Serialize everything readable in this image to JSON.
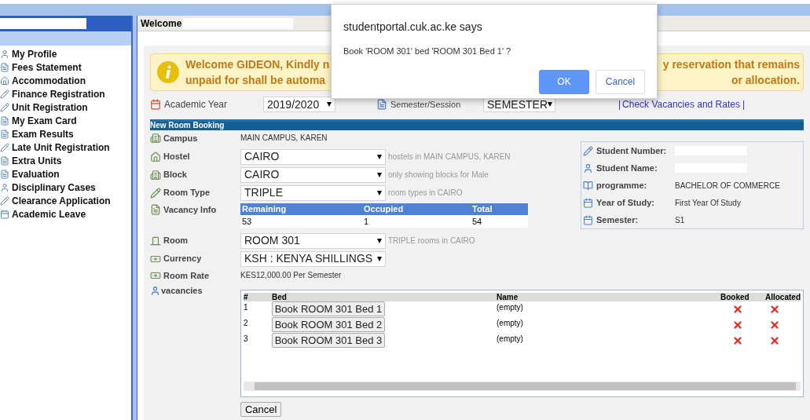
{
  "sidebar": {
    "items": [
      {
        "label": "My Profile"
      },
      {
        "label": "Fees Statement"
      },
      {
        "label": "Accommodation"
      },
      {
        "label": "Finance Registration"
      },
      {
        "label": "Unit Registration"
      },
      {
        "label": "My Exam Card"
      },
      {
        "label": "Exam Results"
      },
      {
        "label": "Late Unit Registration"
      },
      {
        "label": "Extra Units"
      },
      {
        "label": "Evaluation"
      },
      {
        "label": "Disciplinary Cases"
      },
      {
        "label": "Clearance Application"
      },
      {
        "label": "Academic Leave"
      }
    ]
  },
  "welcome_bar": {
    "text": "Welcome"
  },
  "notice": {
    "lines": [
      {
        "left": "Welcome GIDEON, Kindly n",
        "right": "y reservation that remains"
      },
      {
        "left": "unpaid for shall be automa",
        "right": "or allocation."
      }
    ]
  },
  "filters": {
    "academic_year": {
      "label": "Academic Year",
      "value": "2019/2020"
    },
    "semester": {
      "label": "Semester/Session",
      "value": "SEMESTER"
    },
    "link_prefix": "|",
    "link": "Check Vacancies and Rates",
    "link_suffix": "|"
  },
  "booking": {
    "title": "New Room Booking",
    "fields": [
      {
        "kind": "text",
        "label": "Campus",
        "value": "MAIN CAMPUS, KAREN"
      },
      {
        "kind": "select",
        "label": "Hostel",
        "value": "CAIRO",
        "hint": "hostels in MAIN CAMPUS, KAREN"
      },
      {
        "kind": "select",
        "label": "Block",
        "value": "CAIRO",
        "hint": "only showing blocks for Male"
      },
      {
        "kind": "select",
        "label": "Room Type",
        "value": "TRIPLE",
        "hint": "room types in CAIRO"
      },
      {
        "kind": "vacancy",
        "label": "Vacancy Info",
        "columns": [
          "Remaining",
          "Occupied",
          "Total"
        ],
        "values": [
          "53",
          "1",
          "54"
        ]
      },
      {
        "kind": "select",
        "label": "Room",
        "value": "ROOM 301",
        "hint": "TRIPLE rooms in CAIRO"
      },
      {
        "kind": "select",
        "label": "Currency",
        "value": "KSH : KENYA SHILLINGS"
      },
      {
        "kind": "text",
        "label": "Room Rate",
        "value": "KES12,000.00 Per Semester"
      }
    ],
    "vacancies_label": "vacancies"
  },
  "student_info": [
    {
      "label": "Student Number:"
    },
    {
      "label": "Student Name:"
    },
    {
      "label": "programme:",
      "value": "BACHELOR OF COMMERCE"
    },
    {
      "label": "Year of Study:",
      "value": "First Year Of Study"
    },
    {
      "label": "Semester:",
      "value": "S1"
    }
  ],
  "beds": {
    "columns": [
      "#",
      "Bed",
      "Name",
      "Booked",
      "Allocated"
    ],
    "rows": [
      {
        "number": "1",
        "button": "Book ROOM 301 Bed 1",
        "name": "(empty)",
        "booked": false,
        "allocated": false
      },
      {
        "number": "2",
        "button": "Book ROOM 301 Bed 2",
        "name": "(empty)",
        "booked": false,
        "allocated": false
      },
      {
        "number": "3",
        "button": "Book ROOM 301 Bed 3",
        "name": "(empty)",
        "booked": false,
        "allocated": false
      }
    ]
  },
  "cancel_button": "Cancel",
  "dialog": {
    "title": "studentportal.cuk.ac.ke says",
    "message": "Book 'ROOM 301' bed 'ROOM 301 Bed 1' ?",
    "ok": "OK",
    "cancel": "Cancel"
  }
}
